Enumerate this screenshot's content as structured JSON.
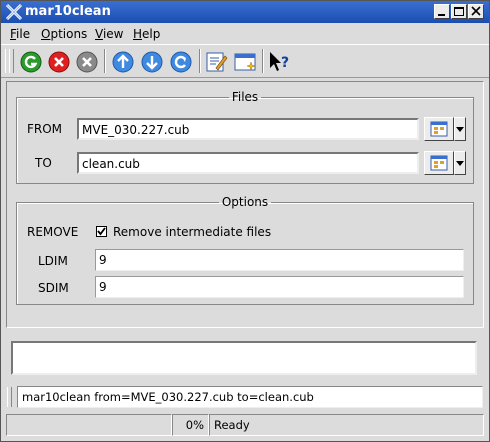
{
  "window": {
    "title": "mar10clean",
    "titlebar_color": "#2457c2"
  },
  "titlebar_buttons": [
    {
      "name": "minimize-icon"
    },
    {
      "name": "maximize-icon"
    },
    {
      "name": "close-icon"
    }
  ],
  "menubar": {
    "file": "File",
    "options": "Options",
    "view": "View",
    "help": "Help"
  },
  "toolbar": {
    "icons": [
      "run-icon",
      "stop-icon",
      "reset-icon",
      "up-arrow-icon",
      "down-arrow-icon",
      "refresh-icon",
      "edit-icon",
      "window-icon",
      "whats-this-icon"
    ]
  },
  "files": {
    "legend": "Files",
    "from_label": "FROM",
    "from_value": "MVE_030.227.cub",
    "to_label": "TO",
    "to_value": "clean.cub"
  },
  "options": {
    "legend": "Options",
    "remove_label": "REMOVE",
    "remove_checkbox_label": "Remove intermediate files",
    "remove_checked": true,
    "ldim_label": "LDIM",
    "ldim_value": "9",
    "sdim_label": "SDIM",
    "sdim_value": "9"
  },
  "command_line": "mar10clean from=MVE_030.227.cub to=clean.cub",
  "status": {
    "progress": "0%",
    "progress_value": 0,
    "state": "Ready"
  }
}
